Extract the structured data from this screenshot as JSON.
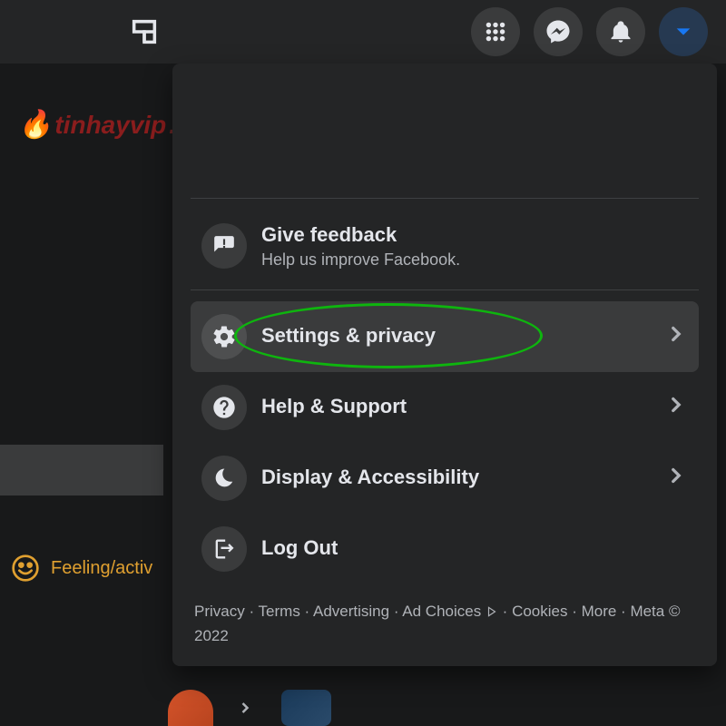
{
  "watermark": {
    "text": "tinhayvip",
    "domain": ".com"
  },
  "menu": {
    "feedback": {
      "title": "Give feedback",
      "subtitle": "Help us improve Facebook."
    },
    "settings": {
      "title": "Settings & privacy"
    },
    "help": {
      "title": "Help & Support"
    },
    "display": {
      "title": "Display & Accessibility"
    },
    "logout": {
      "title": "Log Out"
    }
  },
  "footer": {
    "privacy": "Privacy",
    "terms": "Terms",
    "advertising": "Advertising",
    "adchoices": "Ad Choices",
    "cookies": "Cookies",
    "more": "More",
    "meta": "Meta © 2022"
  },
  "leftPanel": {
    "feeling": "Feeling/activ"
  }
}
